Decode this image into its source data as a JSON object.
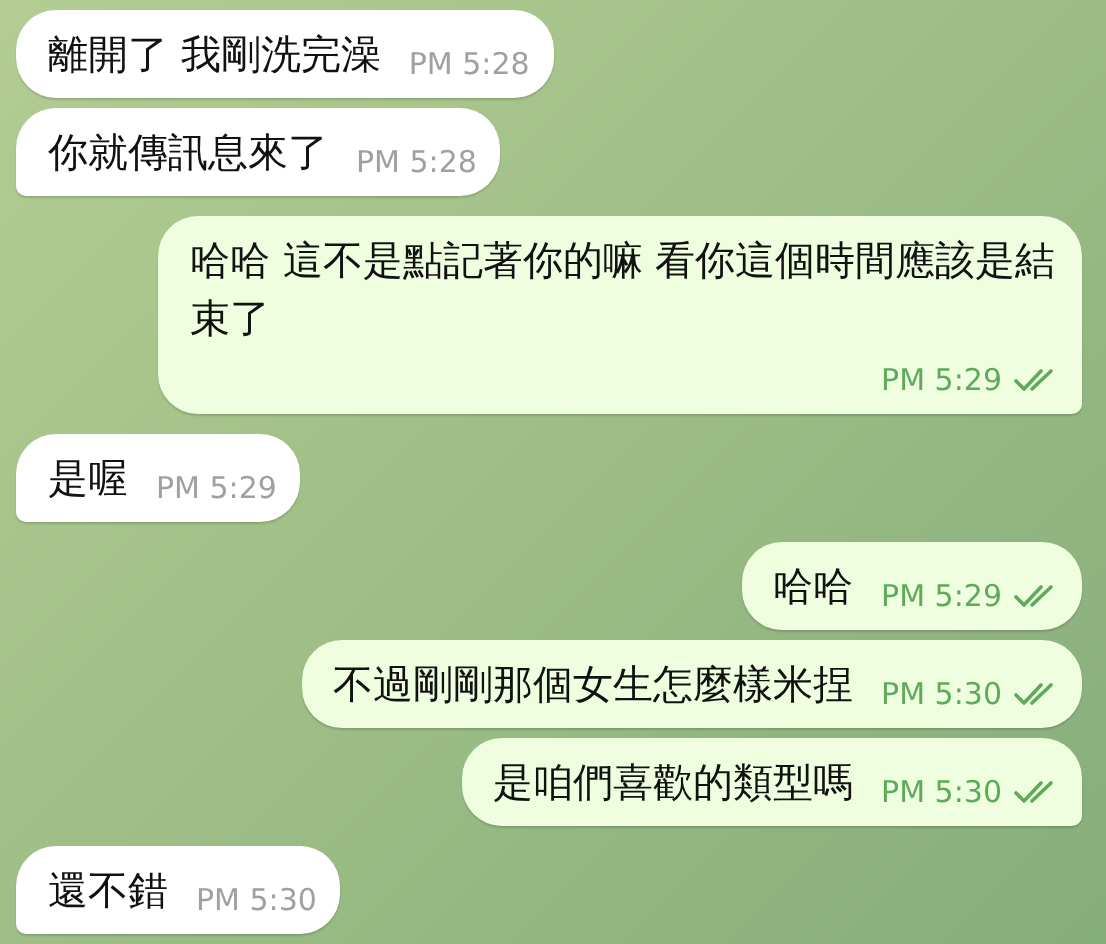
{
  "messages": [
    {
      "kind": "incoming",
      "text": "離開了 我剛洗完澡",
      "time": "PM 5:28",
      "tail": false
    },
    {
      "kind": "incoming",
      "text": "你就傳訊息來了",
      "time": "PM 5:28",
      "tail": true
    },
    {
      "kind": "outgoing",
      "text": "哈哈 這不是點記著你的嘛 看你這個時間應該是結束了",
      "time": "PM 5:29",
      "read": true,
      "tail": true
    },
    {
      "kind": "incoming",
      "text": "是喔",
      "time": "PM 5:29",
      "tail": true
    },
    {
      "kind": "outgoing",
      "text": "哈哈",
      "time": "PM 5:29",
      "read": true,
      "tail": false
    },
    {
      "kind": "outgoing",
      "text": "不過剛剛那個女生怎麼樣米捏",
      "time": "PM 5:30",
      "read": true,
      "tail": false
    },
    {
      "kind": "outgoing",
      "text": "是咱們喜歡的類型嗎",
      "time": "PM 5:30",
      "read": true,
      "tail": true
    },
    {
      "kind": "incoming",
      "text": "還不錯",
      "time": "PM 5:30",
      "tail": true
    }
  ]
}
